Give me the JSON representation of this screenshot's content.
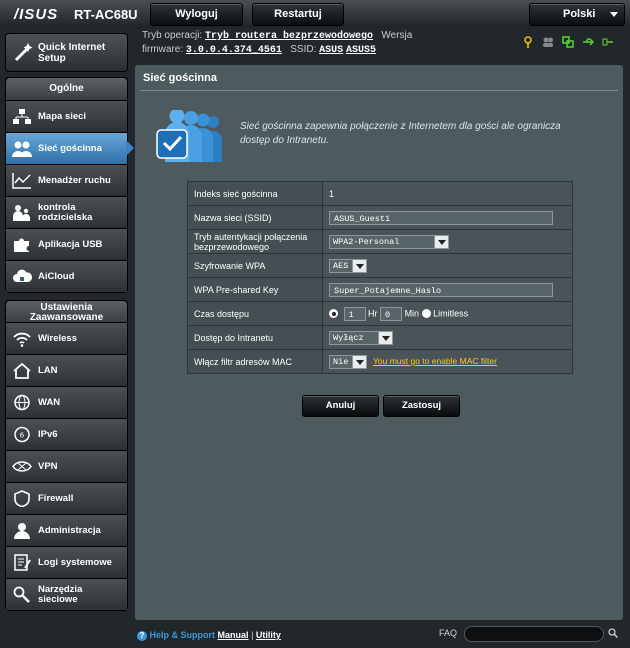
{
  "header": {
    "logo": "/ISUS",
    "model": "RT-AC68U",
    "logout_label": "Wyloguj",
    "restart_label": "Restartuj",
    "language": "Polski"
  },
  "info": {
    "mode_label": "Tryb operacji:",
    "mode_value": "Tryb routera bezprzewodowego",
    "version_label": "Wersja",
    "firmware_label": "firmware:",
    "firmware_value": "3.0.0.4.374_4561",
    "ssid_label": "SSID:",
    "ssid1": "ASUS",
    "ssid2": "ASUS5"
  },
  "sidebar": {
    "qis_label": "Quick Internet Setup",
    "general_title": "Ogólne",
    "general_items": [
      {
        "label": "Mapa sieci"
      },
      {
        "label": "Sieć gościnna"
      },
      {
        "label": "Menadżer ruchu"
      },
      {
        "label": "kontrola rodzicielska"
      },
      {
        "label": "Aplikacja USB"
      },
      {
        "label": "AiCloud"
      }
    ],
    "advanced_title": "Ustawienia Zaawansowane",
    "advanced_items": [
      {
        "label": "Wireless"
      },
      {
        "label": "LAN"
      },
      {
        "label": "WAN"
      },
      {
        "label": "IPv6"
      },
      {
        "label": "VPN"
      },
      {
        "label": "Firewall"
      },
      {
        "label": "Administracja"
      },
      {
        "label": "Logi systemowe"
      },
      {
        "label": "Narzędzia sieciowe"
      }
    ]
  },
  "main": {
    "title": "Sieć gościnna",
    "description": "Sieć gościnna zapewnia połączenie z Internetem dla gości ale ogranicza dostęp do Intranetu.",
    "rows": {
      "index_label": "Indeks sieć gościnna",
      "index_value": "1",
      "ssid_label": "Nazwa sieci (SSID)",
      "ssid_value": "ASUS_Guest1",
      "auth_label": "Tryb autentykacji połączenia bezprzewodowego",
      "auth_value": "WPA2-Personal",
      "enc_label": "Szyfrowanie WPA",
      "enc_value": "AES",
      "psk_label": "WPA Pre-shared Key",
      "psk_value": "Super_Potajemne_Haslo",
      "time_label": "Czas dostępu",
      "time_hr_value": "1",
      "time_hr_unit": "Hr",
      "time_min_value": "0",
      "time_min_unit": "Min",
      "time_limitless": "Limitless",
      "intranet_label": "Dostęp do Intranetu",
      "intranet_value": "Wyłącz",
      "mac_label": "Włącz filtr adresów MAC",
      "mac_value": "Nie",
      "mac_link": "You must go to enable MAC filter"
    },
    "cancel_label": "Anuluj",
    "apply_label": "Zastosuj"
  },
  "footer": {
    "help": "Help & Support",
    "manual": "Manual",
    "separator": "|",
    "utility": "Utility",
    "faq": "FAQ"
  }
}
